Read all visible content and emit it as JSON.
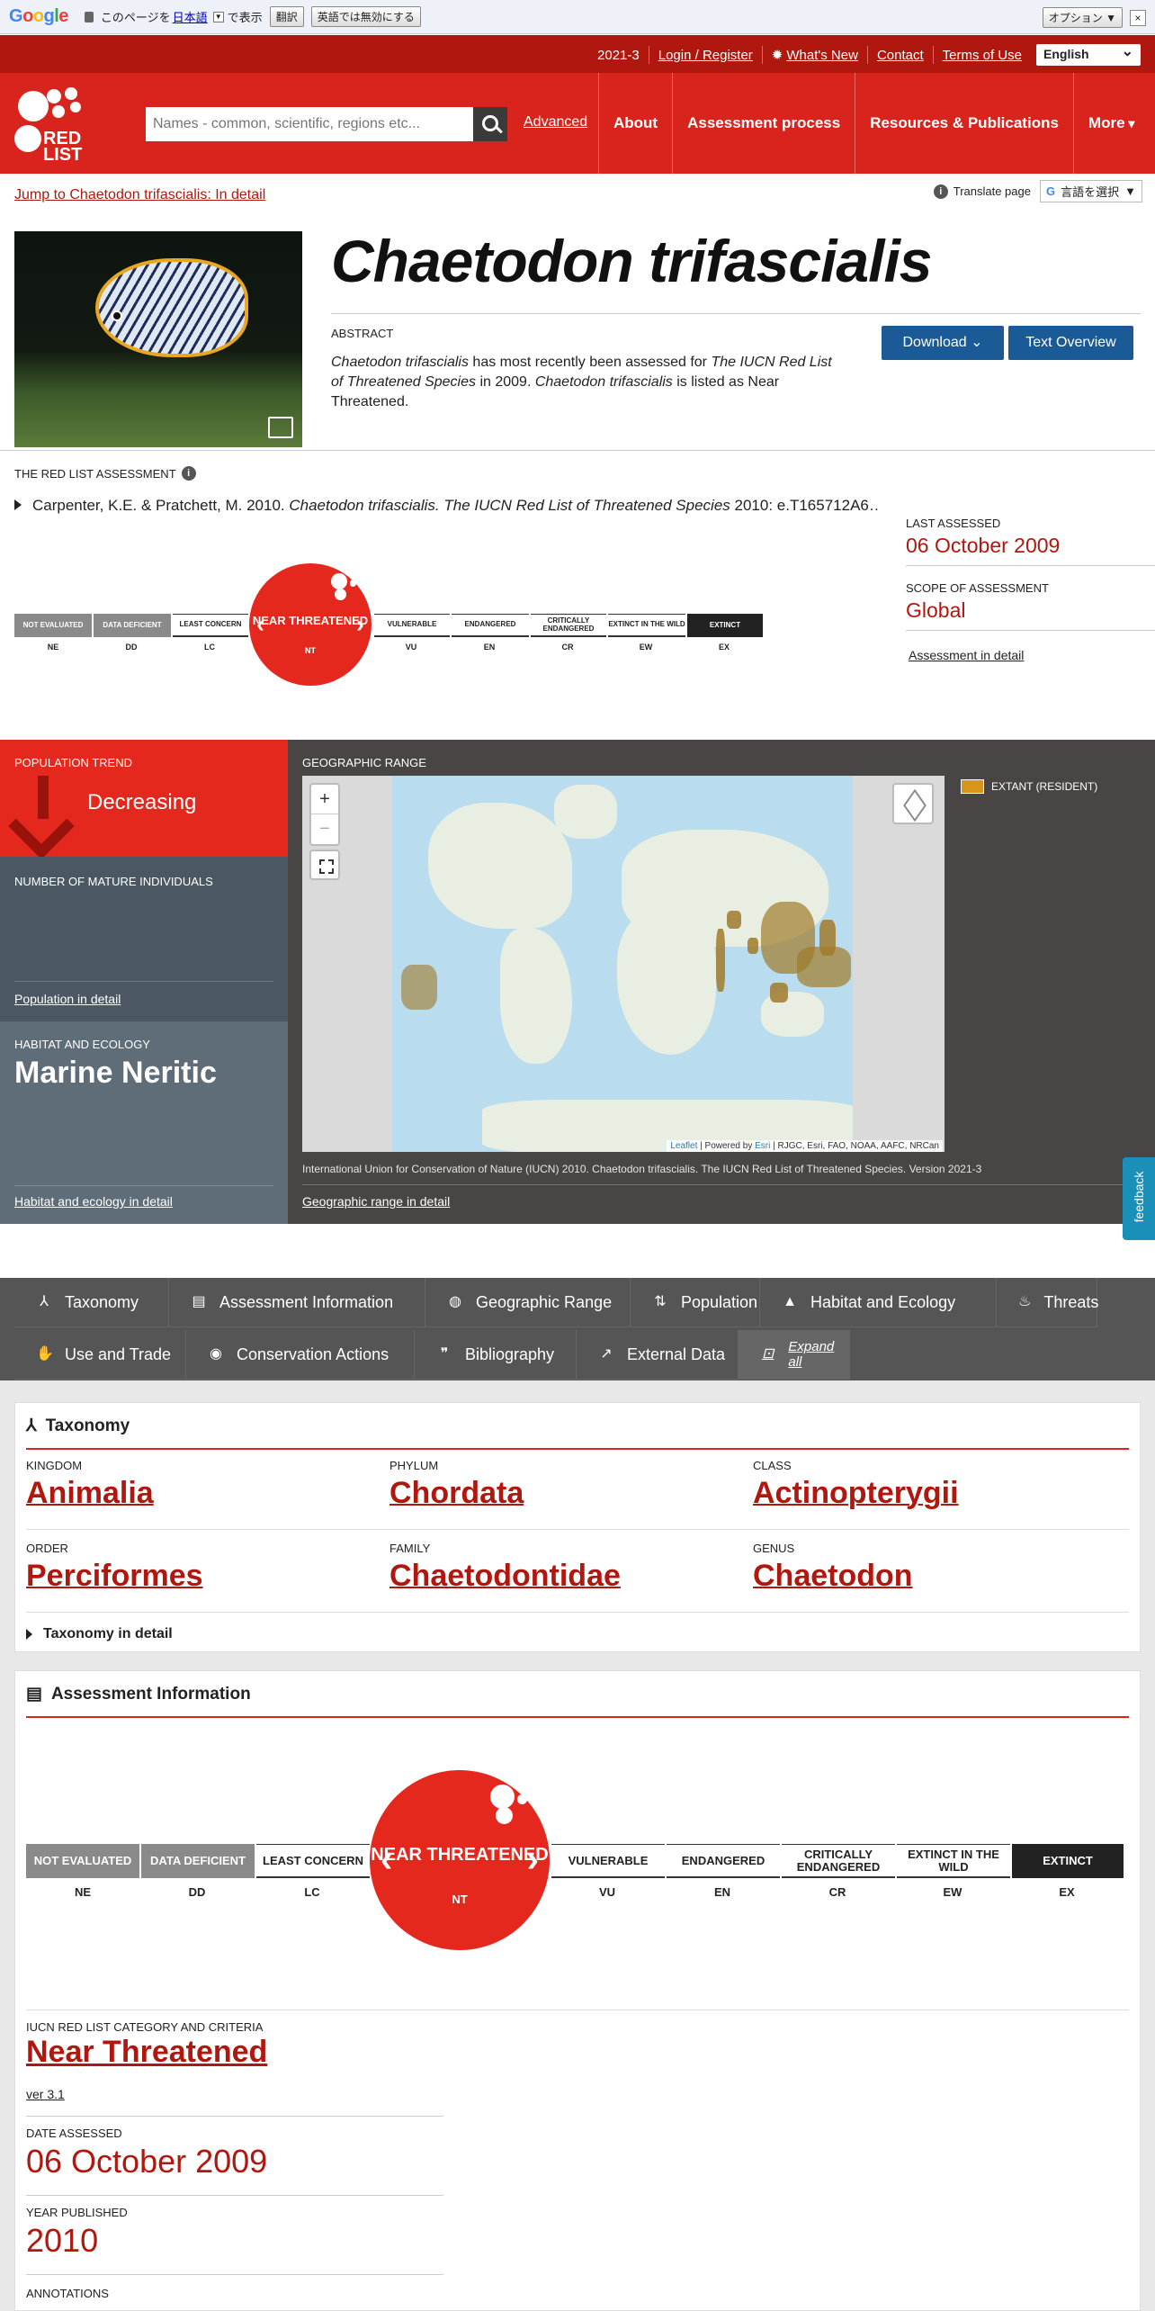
{
  "translate_bar": {
    "logo": "Google",
    "prefix": "このページを",
    "lang": "日本語",
    "suffix": "で表示",
    "translate_button": "翻訳",
    "disable_button": "英語では無効にする",
    "options_button": "オプション ▼",
    "close": "×"
  },
  "header": {
    "version": "2021-3",
    "login": "Login / Register",
    "whats_new": "What's New",
    "contact": "Contact",
    "terms": "Terms of Use",
    "language": "English",
    "logo_text": "RED LIST",
    "search_placeholder": "Names - common, scientific, regions etc...",
    "advanced": "Advanced",
    "nav": [
      "About",
      "Assessment process",
      "Resources & Publications",
      "More"
    ]
  },
  "hero": {
    "jump_link": "Jump to Chaetodon trifascialis: In detail",
    "translate_label": "Translate page",
    "translate_select": "言語を選択",
    "species": "Chaetodon trifascialis",
    "abstract_heading": "ABSTRACT",
    "abstract_p1": "Chaetodon trifascialis",
    "abstract_p2": " has most recently been assessed for ",
    "abstract_p3": "The IUCN Red List of Threatened Species",
    "abstract_p4": " in 2009. ",
    "abstract_p5": "Chaetodon trifascialis",
    "abstract_p6": " is listed as Near Threatened.",
    "download": "Download",
    "text_overview": "Text Overview"
  },
  "assessment": {
    "heading": "THE RED LIST ASSESSMENT",
    "citation_a": "Carpenter, K.E. & Pratchett, M. 2010. ",
    "citation_b": "Chaetodon trifascialis. The IUCN Red List of Threatened Species",
    "citation_c": " 2010: e.T165712A6…",
    "last_assessed_label": "LAST ASSESSED",
    "last_assessed": "06 October 2009",
    "scope_label": "SCOPE OF ASSESSMENT",
    "scope": "Global",
    "detail_link": "Assessment in detail"
  },
  "scale": {
    "categories": [
      {
        "label": "NOT EVALUATED",
        "abbr": "NE"
      },
      {
        "label": "DATA DEFICIENT",
        "abbr": "DD"
      },
      {
        "label": "LEAST CONCERN",
        "abbr": "LC"
      },
      {
        "label": "NEAR THREATENED",
        "abbr": "NT"
      },
      {
        "label": "VULNERABLE",
        "abbr": "VU"
      },
      {
        "label": "ENDANGERED",
        "abbr": "EN"
      },
      {
        "label": "CRITICALLY ENDANGERED",
        "abbr": "CR"
      },
      {
        "label": "EXTINCT IN THE WILD",
        "abbr": "EW"
      },
      {
        "label": "EXTINCT",
        "abbr": "EX"
      }
    ],
    "selected": "NEAR THREATENED",
    "selected_abbr": "NT"
  },
  "summary": {
    "trend_label": "POPULATION TREND",
    "trend": "Decreasing",
    "mature_label": "NUMBER OF MATURE INDIVIDUALS",
    "population_link": "Population in detail",
    "habitat_label": "HABITAT AND ECOLOGY",
    "habitat": "Marine Neritic",
    "habitat_link": "Habitat and ecology in detail",
    "geo_label": "GEOGRAPHIC RANGE",
    "legend": "EXTANT (RESIDENT)",
    "legend_color": "#d9951b",
    "map_attr_a": "Leaflet",
    "map_attr_b": " | Powered by ",
    "map_attr_c": "Esri",
    "map_attr_d": " | RJGC, Esri, FAO, NOAA, AAFC, NRCan",
    "geo_citation": "International Union for Conservation of Nature (IUCN) 2010. Chaetodon trifascialis. The IUCN Red List of Threatened Species. Version 2021-3",
    "geo_link": "Geographic range in detail",
    "feedback": "feedback"
  },
  "tabs": [
    {
      "label": "Taxonomy",
      "icon": "taxonomy-icon",
      "glyph": "⅄"
    },
    {
      "label": "Assessment Information",
      "icon": "clipboard-icon",
      "glyph": "▤"
    },
    {
      "label": "Geographic Range",
      "icon": "globe-icon",
      "glyph": "◍"
    },
    {
      "label": "Population",
      "icon": "sort-arrows-icon",
      "glyph": "⇅"
    },
    {
      "label": "Habitat and Ecology",
      "icon": "mountain-icon",
      "glyph": "▲"
    },
    {
      "label": "Threats",
      "icon": "flame-icon",
      "glyph": "♨"
    },
    {
      "label": "Use and Trade",
      "icon": "hand-icon",
      "glyph": "✋"
    },
    {
      "label": "Conservation Actions",
      "icon": "eye-icon",
      "glyph": "◉"
    },
    {
      "label": "Bibliography",
      "icon": "quote-icon",
      "glyph": "❞"
    },
    {
      "label": "External Data",
      "icon": "external-link-icon",
      "glyph": "↗"
    },
    {
      "label": "Expand all",
      "icon": "expand-icon",
      "glyph": "⊡"
    }
  ],
  "taxonomy": {
    "heading": "Taxonomy",
    "kingdom_label": "KINGDOM",
    "kingdom": "Animalia",
    "phylum_label": "PHYLUM",
    "phylum": "Chordata",
    "class_label": "CLASS",
    "class": "Actinopterygii",
    "order_label": "ORDER",
    "order": "Perciformes",
    "family_label": "FAMILY",
    "family": "Chaetodontidae",
    "genus_label": "GENUS",
    "genus": "Chaetodon",
    "detail": "Taxonomy in detail"
  },
  "assessment_info": {
    "heading": "Assessment Information",
    "category_label": "IUCN RED LIST CATEGORY AND CRITERIA",
    "category": "Near Threatened",
    "version": "ver 3.1",
    "date_label": "DATE ASSESSED",
    "date": "06 October 2009",
    "year_label": "YEAR PUBLISHED",
    "year": "2010",
    "annotations_label": "ANNOTATIONS"
  }
}
